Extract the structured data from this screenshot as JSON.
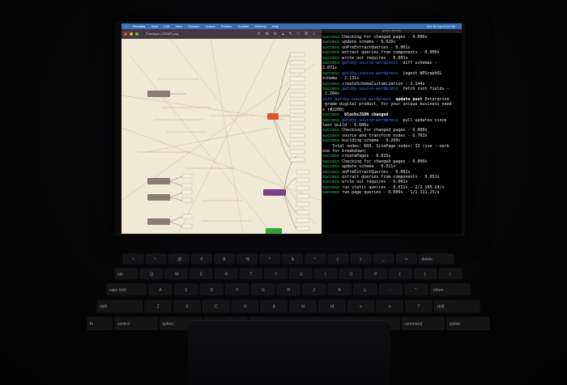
{
  "menubar": {
    "app_name": "Preview",
    "items": [
      "Shell",
      "Edit",
      "View",
      "Session",
      "Scripts",
      "Profiles",
      "Toolbelt",
      "Window",
      "Help"
    ],
    "clock": "Sat 16 Jun  9:24 PM"
  },
  "preview": {
    "file_title": "Prototype-CSS6IS.png"
  },
  "terminal": {
    "title": "gatsby develop",
    "lines": [
      {
        "status": "success",
        "text": " Checking for changed pages - 0.000s"
      },
      {
        "status": "success",
        "text": " update schema - 0.026s"
      },
      {
        "status": "success",
        "text": " onPreExtractQueries - 0.001s"
      },
      {
        "status": "success",
        "text": " extract queries from components - 0.000s"
      },
      {
        "status": "success",
        "text": " write out requires - 0.001s"
      },
      {
        "status": "success",
        "plugin": " gatsby-source-wordpress",
        "text": "  diff schemas -"
      },
      {
        "status": "",
        "text": "2.071s"
      },
      {
        "status": "success",
        "plugin": " gatsby-source-wordpress",
        "text": "  ingest WPGraphQL"
      },
      {
        "status": "",
        "text": "schema - 2.131s"
      },
      {
        "status": "success",
        "text": " createSchemaCustomization - 2.144s"
      },
      {
        "status": "success",
        "plugin": " gatsby-source-wordpress",
        "text": "  fetch root fields -"
      },
      {
        "status": "",
        "text": " 1.204s"
      },
      {
        "status": "",
        "text": ""
      },
      {
        "status": "info",
        "plugin": " gatsby-source-wordpress",
        "text": "  update post",
        "suffix": " Enterprise"
      },
      {
        "status": "",
        "text": "-grade digital product, for your unique business need"
      },
      {
        "status": "",
        "text": "s (#2200)"
      },
      {
        "status": "",
        "text": ""
      },
      {
        "status": "",
        "text": ""
      },
      {
        "status": "success",
        "text": "  blocksJSON changed",
        "bold": true
      },
      {
        "status": "success",
        "plugin": " gatsby-source-wordpress",
        "text": "  pull updates since"
      },
      {
        "status": "",
        "text": "last build - 6.086s"
      },
      {
        "status": "success",
        "text": " Checking for changed pages - 0.000s"
      },
      {
        "status": "success",
        "text": " source and transform nodes - 6.703s"
      },
      {
        "status": "success",
        "text": " building schema - 0.209s"
      },
      {
        "status": "",
        "text": "    Total nodes: 609, SitePage nodes: 33 (use --verb"
      },
      {
        "status": "",
        "text": "ose for breakdown)"
      },
      {
        "status": "success",
        "text": " createPages - 0.016s"
      },
      {
        "status": "success",
        "text": " Checking for changed pages - 0.000s"
      },
      {
        "status": "success",
        "text": " update schema - 0.011s"
      },
      {
        "status": "success",
        "text": " onPreExtractQueries - 0.002s"
      },
      {
        "status": "success",
        "text": " extract queries from components - 0.051s"
      },
      {
        "status": "success",
        "text": " write out requires - 0.001s"
      },
      {
        "status": "success",
        "text": " run static queries - 0.011s - 2/2 185.24/s"
      },
      {
        "status": "success",
        "text": " run page queries - 0.009s - 1/1 111.25/s"
      }
    ]
  },
  "keyboard": {
    "row1": [
      "~",
      "!",
      "@",
      "#",
      "$",
      "%",
      "^",
      "&",
      "*",
      "(",
      ")",
      "_",
      "+",
      "delete"
    ],
    "row2": [
      "tab",
      "Q",
      "W",
      "E",
      "R",
      "T",
      "Y",
      "U",
      "I",
      "O",
      "P",
      "{",
      "}",
      "|"
    ],
    "row3": [
      "caps lock",
      "A",
      "S",
      "D",
      "F",
      "G",
      "H",
      "J",
      "K",
      "L",
      ":",
      "\"",
      "return"
    ],
    "row4": [
      "shift",
      "Z",
      "X",
      "C",
      "V",
      "B",
      "N",
      "M",
      "<",
      ">",
      "?",
      "shift"
    ],
    "row5": [
      "fn",
      "control",
      "option",
      "command",
      "",
      "command",
      "option"
    ]
  }
}
